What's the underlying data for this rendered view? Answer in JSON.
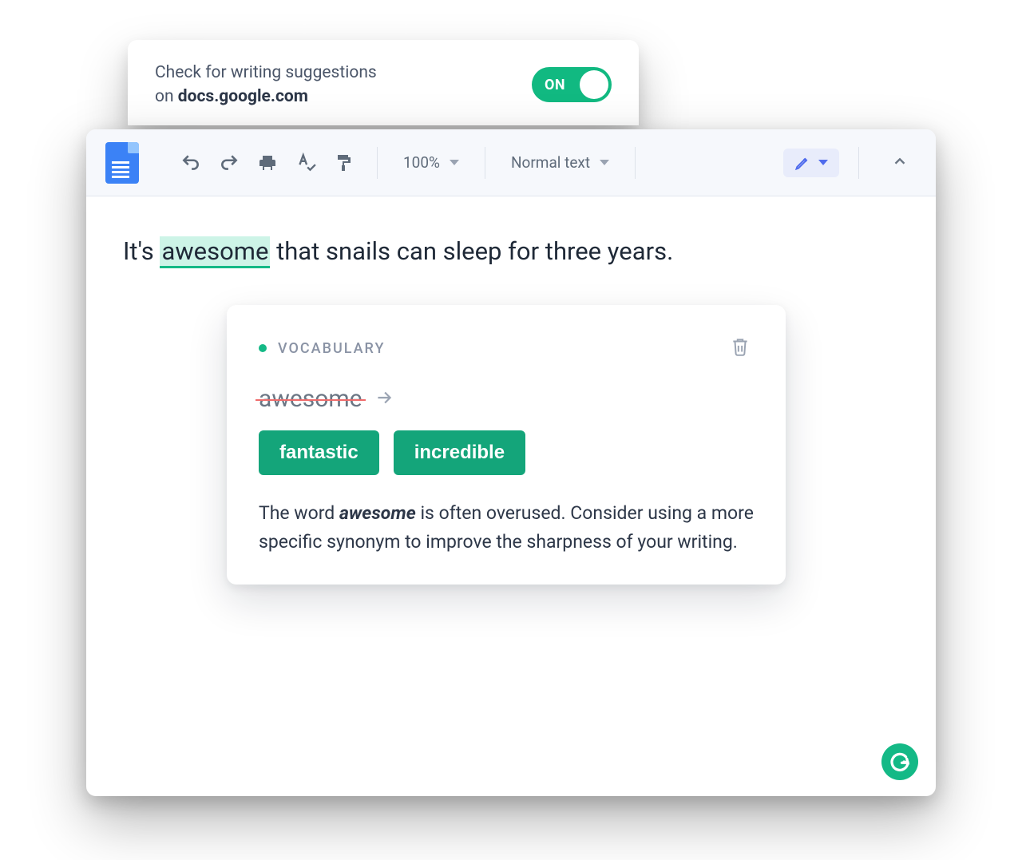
{
  "toggleCard": {
    "line1": "Check for writing suggestions",
    "line2_prefix": "on ",
    "domain": "docs.google.com",
    "switch_label": "ON"
  },
  "toolbar": {
    "zoom": "100%",
    "style": "Normal text"
  },
  "document": {
    "before": "It's ",
    "highlight": "awesome",
    "after": " that snails can sleep for three years."
  },
  "suggestion": {
    "category": "VOCABULARY",
    "original": "awesome",
    "options": [
      "fantastic",
      "incredible"
    ],
    "exp_pre": "The word ",
    "exp_word": "awesome",
    "exp_post": " is often overused. Consider using a more specific synonym to improve the sharpness of your writing."
  }
}
